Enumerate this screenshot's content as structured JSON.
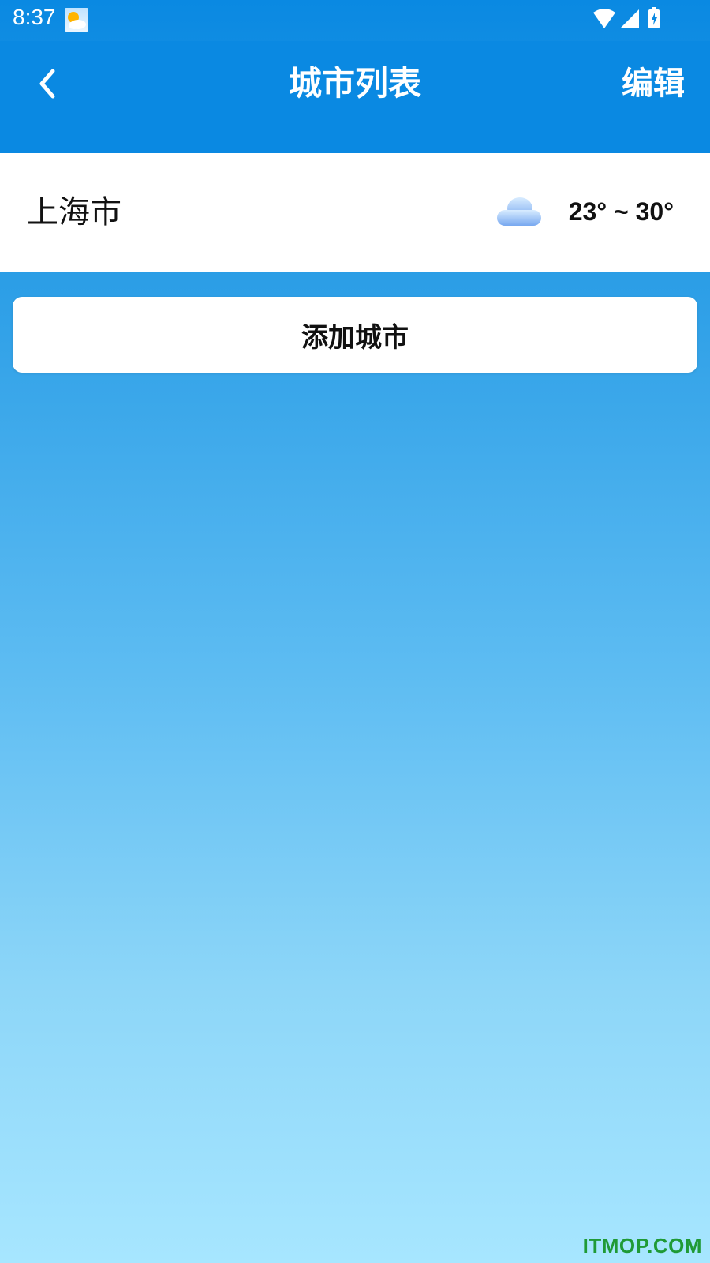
{
  "status_bar": {
    "time": "8:37",
    "icons": [
      "weather-app-icon",
      "wifi-icon",
      "signal-icon",
      "battery-charging-icon"
    ]
  },
  "header": {
    "back_icon": "chevron-left-icon",
    "title": "城市列表",
    "edit_label": "编辑"
  },
  "cities": [
    {
      "name": "上海市",
      "weather_icon": "cloud-icon",
      "temp_range": "23° ~ 30°"
    }
  ],
  "add_city_label": "添加城市",
  "watermark": "ITMOP.COM",
  "colors": {
    "header_bg": "#0a89e2",
    "gradient_bottom": "#a7e6ff",
    "card_bg": "#ffffff",
    "watermark": "#1f9a36"
  }
}
